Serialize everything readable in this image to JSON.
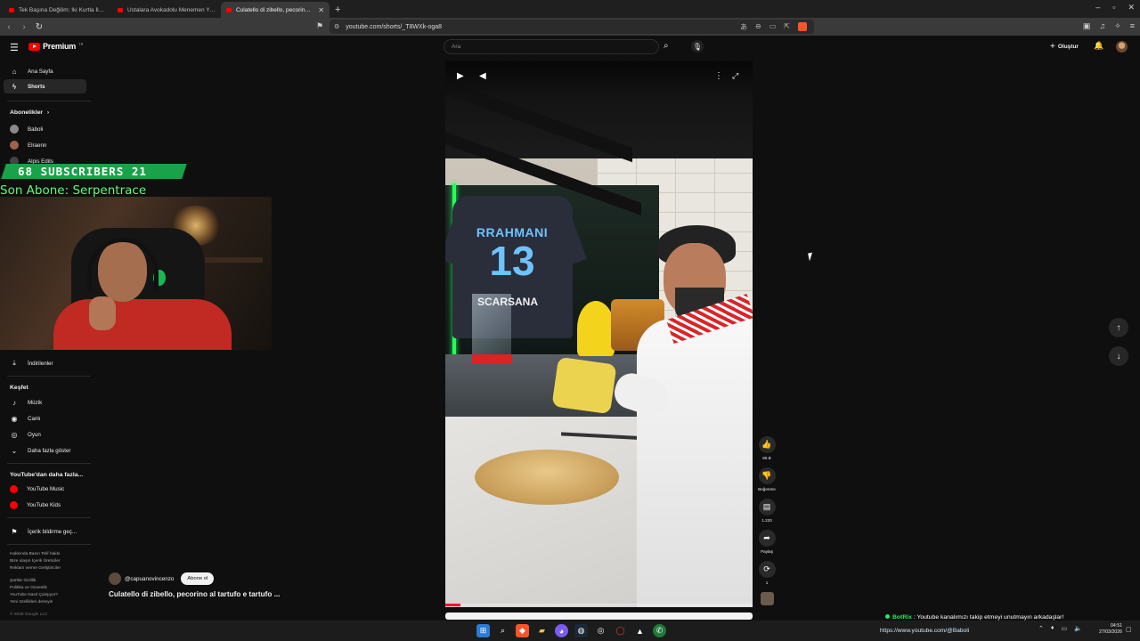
{
  "browser": {
    "tabs": [
      {
        "title": "Tek Başına Değilim: İki Kurtla İlk Sokak...",
        "active": false
      },
      {
        "title": "Ustalara Avokadolu Menemen Yaptık...",
        "active": false
      },
      {
        "title": "Culatello di zibello, pecorino al t...",
        "active": true
      }
    ],
    "url": "youtube.com/shorts/_T8WXk-oga8"
  },
  "header": {
    "logo_text": "Premium",
    "logo_tm": "TR",
    "search_placeholder": "Ara",
    "create_label": "Oluştur"
  },
  "sidebar": {
    "home": "Ana Sayfa",
    "shorts": "Shorts",
    "subscriptions_heading": "Abonelikler",
    "subscriptions_chevron": "›",
    "channels": [
      "Baboli",
      "Elraenn",
      "Alpis Edits"
    ],
    "downloads": "İndirilenler",
    "explore_heading": "Keşfet",
    "music": "Müzik",
    "live": "Canlı",
    "gaming": "Oyun",
    "show_more": "Daha fazla göster",
    "more_from_heading": "YouTube'dan daha fazla...",
    "yt_music": "YouTube Music",
    "yt_kids": "YouTube Kids",
    "report_history": "İçerik bildirme geç...",
    "footer_lines": [
      "Hakkında  Basın  Telif hakkı",
      "Bize ulaşın  İçerik Üreticiler",
      "Reklam verme  Geliştiriciler",
      "",
      "Şartlar  Gizlilik",
      "Politika ve Güvenlik",
      "YouTube Nasıl Çalışıyor?",
      "Yeni özellikleri deneyin"
    ],
    "copyright": "© 2026 Google LLC"
  },
  "overlay": {
    "subscribers_banner": "68  SUBSCRIBERS  21",
    "last_subscriber": "Son Abone: Serpentrace"
  },
  "short": {
    "jersey_name": "RRAHMANI",
    "jersey_number": "13",
    "trophy_text": "SCARSANA",
    "progress": 0.05,
    "channel": "@capuanovincenzo",
    "subscribe": "Abone ol",
    "title": "Culatello di zibello, pecorino al tartufo e tartufo ..."
  },
  "actions": {
    "likes": "86 B",
    "dislike": "Beğenme",
    "comments": "1.220",
    "share": "Paylaş",
    "remix": "1"
  },
  "chat": {
    "bot_name": "BotRix",
    "message": " : Youtube kanalımızı takip etmeyi unutmayın arkadaşlar!",
    "url": "https://www.youtube.com/@Baboli"
  },
  "clock": {
    "time": "04:51",
    "date": "27/03/2026"
  },
  "colors": {
    "yt_red": "#ff0000",
    "banner_green": "#1aa24a",
    "overlay_green": "#5dff7a"
  }
}
